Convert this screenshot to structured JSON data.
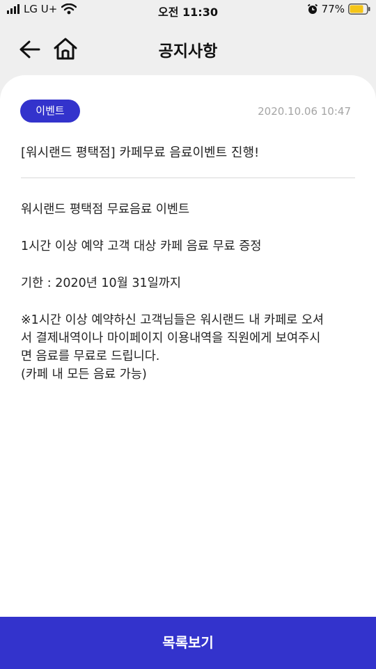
{
  "status_bar": {
    "carrier": "LG U+",
    "time": "오전 11:30",
    "battery": "77%",
    "icons": [
      "signal-icon",
      "wifi-icon",
      "alarm-icon",
      "battery-icon"
    ],
    "battery_color": "#f5c518"
  },
  "header": {
    "title": "공지사항",
    "back_icon": "arrow-left-icon",
    "home_icon": "home-icon"
  },
  "notice": {
    "category": "이벤트",
    "date": "2020.10.06 10:47",
    "title": "[워시랜드 평택점] 카페무료 음료이벤트 진행!",
    "body": {
      "line1": "워시랜드 평택점 무료음료 이벤트",
      "line2": "1시간 이상 예약 고객 대상 카페 음료 무료 증정",
      "line3": "기한 : 2020년 10월 31일까지",
      "line4a": "※1시간 이상 예약하신 고객님들은 워시랜드 내 카페로 오셔",
      "line4b": "서 결제내역이나 마이페이지 이용내역을 직원에게 보여주시",
      "line4c": "면 음료를 무료로 드립니다.",
      "line4d": "(카페 내 모든 음료 가능)"
    }
  },
  "footer": {
    "list_button": "목록보기"
  },
  "colors": {
    "accent": "#3333cc",
    "background": "#efefef",
    "date_text": "#a5a5a5"
  }
}
